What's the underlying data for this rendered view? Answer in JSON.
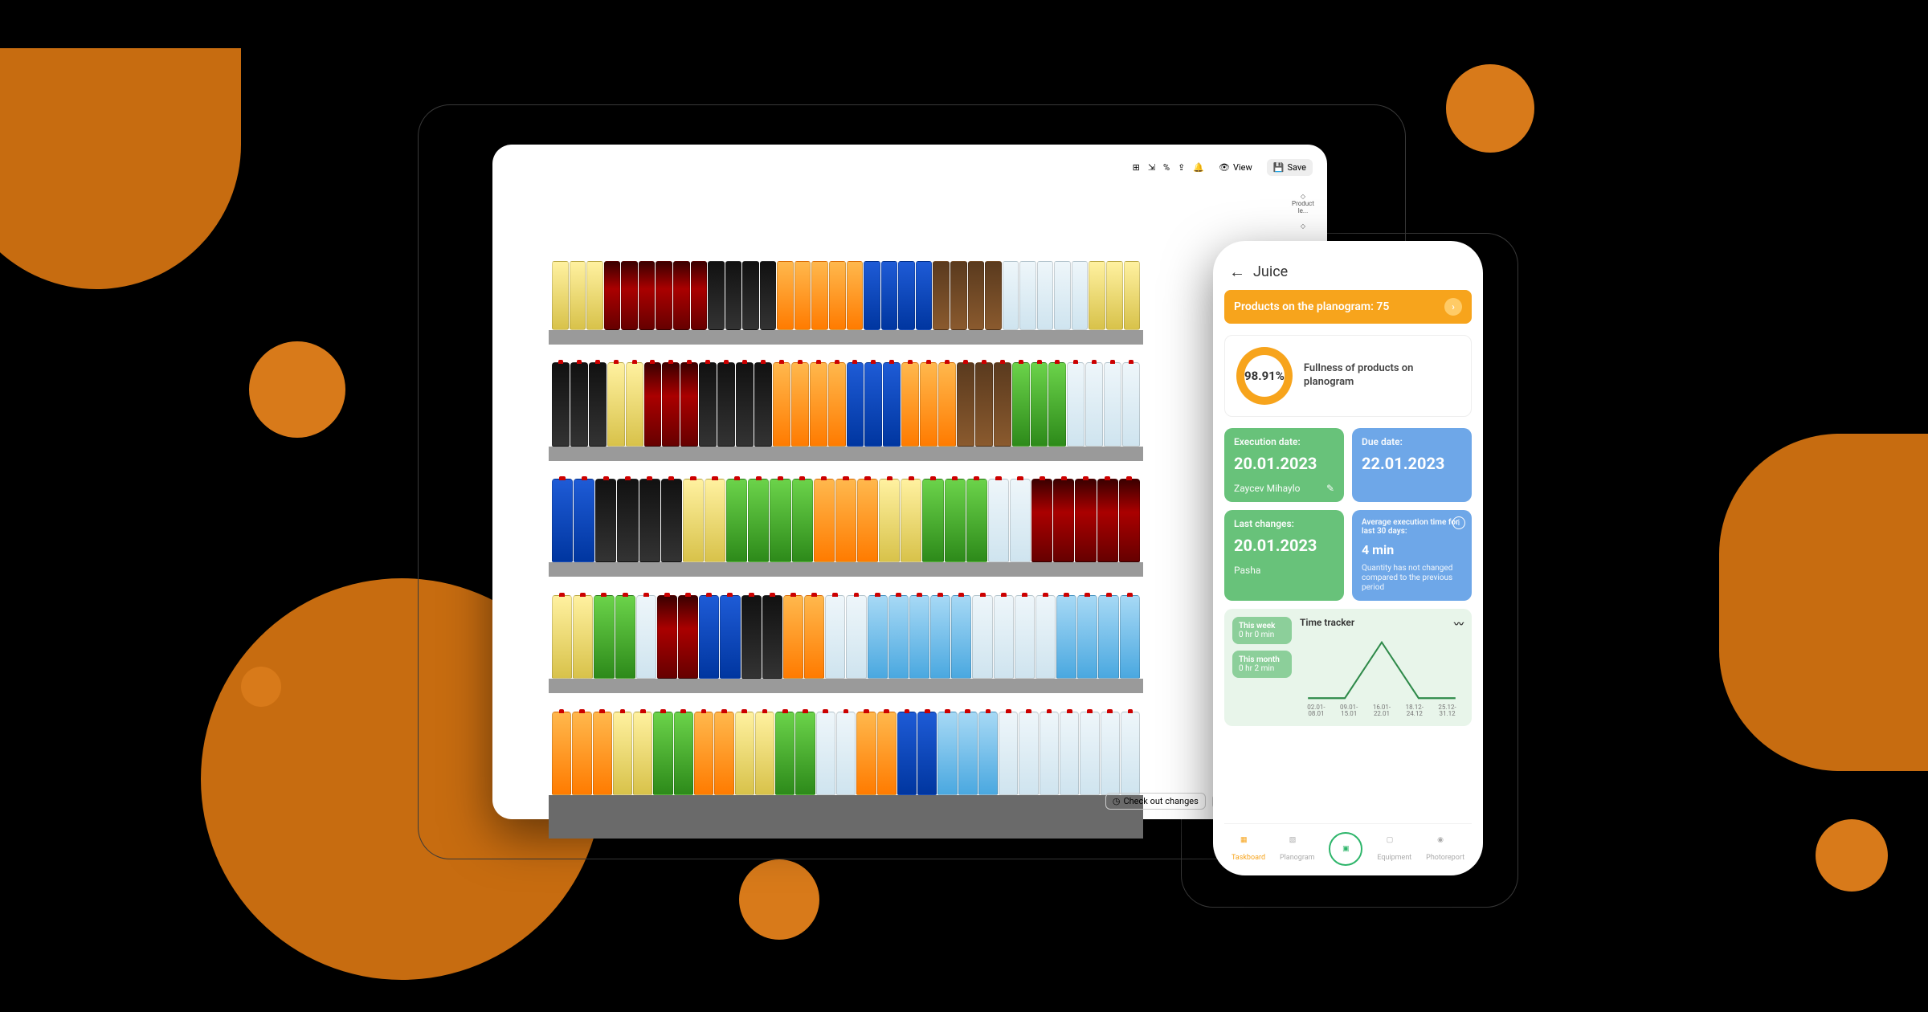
{
  "tablet": {
    "toolbar": {
      "view_label": "View",
      "save_label": "Save"
    },
    "side": {
      "product_label": "Product le..."
    },
    "footer": {
      "check_label": "Check out changes"
    },
    "shelves": [
      {
        "items": [
          {
            "c": "yellow",
            "n": 3,
            "t": "can"
          },
          {
            "c": "red",
            "n": 6,
            "t": "can"
          },
          {
            "c": "black",
            "n": 4,
            "t": "can"
          },
          {
            "c": "orange",
            "n": 5,
            "t": "can"
          },
          {
            "c": "blue",
            "n": 4,
            "t": "can"
          },
          {
            "c": "brown",
            "n": 4,
            "t": "can"
          },
          {
            "c": "clear",
            "n": 5,
            "t": "can"
          },
          {
            "c": "yellow",
            "n": 3,
            "t": "can"
          }
        ]
      },
      {
        "items": [
          {
            "c": "black",
            "n": 3
          },
          {
            "c": "yellow",
            "n": 2
          },
          {
            "c": "red",
            "n": 3
          },
          {
            "c": "black",
            "n": 4
          },
          {
            "c": "orange",
            "n": 4
          },
          {
            "c": "blue",
            "n": 3
          },
          {
            "c": "orange",
            "n": 3
          },
          {
            "c": "brown",
            "n": 3
          },
          {
            "c": "green",
            "n": 3
          },
          {
            "c": "clear",
            "n": 4
          }
        ]
      },
      {
        "items": [
          {
            "c": "blue",
            "n": 2
          },
          {
            "c": "black",
            "n": 4
          },
          {
            "c": "yellow",
            "n": 2
          },
          {
            "c": "green",
            "n": 4
          },
          {
            "c": "orange",
            "n": 3
          },
          {
            "c": "yellow",
            "n": 2
          },
          {
            "c": "green",
            "n": 3
          },
          {
            "c": "clear",
            "n": 2
          },
          {
            "c": "red",
            "n": 3
          },
          {
            "c": "red",
            "n": 2
          }
        ]
      },
      {
        "items": [
          {
            "c": "yellow",
            "n": 2
          },
          {
            "c": "green",
            "n": 2
          },
          {
            "c": "clear",
            "n": 1
          },
          {
            "c": "red",
            "n": 2
          },
          {
            "c": "blue",
            "n": 2
          },
          {
            "c": "black",
            "n": 2
          },
          {
            "c": "orange",
            "n": 2
          },
          {
            "c": "clear",
            "n": 2
          },
          {
            "c": "lblue",
            "n": 5
          },
          {
            "c": "clear",
            "n": 4
          },
          {
            "c": "lblue",
            "n": 4
          }
        ]
      },
      {
        "items": [
          {
            "c": "orange",
            "n": 3
          },
          {
            "c": "yellow",
            "n": 2
          },
          {
            "c": "green",
            "n": 2
          },
          {
            "c": "orange",
            "n": 2
          },
          {
            "c": "yellow",
            "n": 2
          },
          {
            "c": "green",
            "n": 2
          },
          {
            "c": "clear",
            "n": 2
          },
          {
            "c": "orange",
            "n": 2
          },
          {
            "c": "blue",
            "n": 2
          },
          {
            "c": "lblue",
            "n": 3
          },
          {
            "c": "clear",
            "n": 4
          },
          {
            "c": "clear",
            "n": 3
          }
        ]
      }
    ]
  },
  "phone": {
    "title": "Juice",
    "banner": "Products on the planogram: 75",
    "fullness": {
      "pct": "98.91%",
      "label": "Fullness of products on planogram"
    },
    "exec": {
      "label": "Execution date:",
      "date": "20.01.2023",
      "user": "Zaycev Mihaylo"
    },
    "due": {
      "label": "Due date:",
      "date": "22.01.2023"
    },
    "last": {
      "label": "Last changes:",
      "date": "20.01.2023",
      "user": "Pasha"
    },
    "avg": {
      "label": "Average execution time for last 30 days:",
      "value": "4 min",
      "note": "Quantity has not changed compared to the previous period"
    },
    "tracker": {
      "title": "Time tracker",
      "week": {
        "label": "This week",
        "value": "0 hr 0 min"
      },
      "month": {
        "label": "This month",
        "value": "0 hr 2 min"
      },
      "x": [
        "02.01-08.01",
        "09.01-15.01",
        "16.01-22.01",
        "18.12-24.12",
        "25.12-31.12"
      ]
    },
    "nav": {
      "taskboard": "Taskboard",
      "planogram": "Planogram",
      "equipment": "Equipment",
      "photoreport": "Photoreport"
    }
  },
  "chart_data": {
    "type": "line",
    "title": "Time tracker",
    "categories": [
      "02.01-08.01",
      "09.01-15.01",
      "16.01-22.01",
      "18.12-24.12",
      "25.12-31.12"
    ],
    "values": [
      0,
      0,
      2,
      0,
      0
    ],
    "ylabel": "min",
    "ylim": [
      0,
      2
    ]
  }
}
